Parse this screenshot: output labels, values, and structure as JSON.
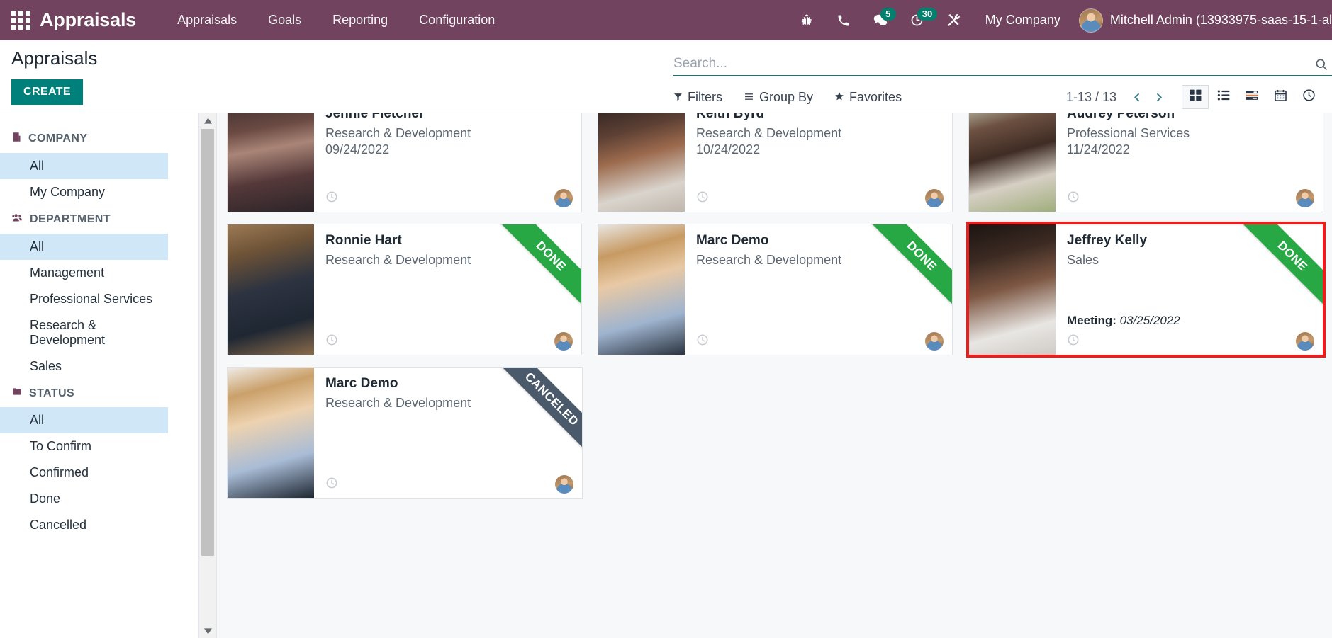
{
  "navbar": {
    "apps_icon": "apps-grid-icon",
    "brand": "Appraisals",
    "menu": [
      {
        "label": "Appraisals"
      },
      {
        "label": "Goals"
      },
      {
        "label": "Reporting"
      },
      {
        "label": "Configuration"
      }
    ],
    "sysicons": [
      {
        "name": "bug-icon",
        "badge": null
      },
      {
        "name": "phone-icon",
        "badge": null
      },
      {
        "name": "messages-icon",
        "badge": "5"
      },
      {
        "name": "activities-clock-icon",
        "badge": "30"
      },
      {
        "name": "tools-icon",
        "badge": null
      }
    ],
    "company": "My Company",
    "user": "Mitchell Admin (13933975-saas-15-1-al",
    "accent": "#71435f",
    "badge_color": "#00806e"
  },
  "control_panel": {
    "title": "Appraisals",
    "create_label": "CREATE",
    "search": {
      "placeholder": "Search...",
      "value": "",
      "icon": "search-icon"
    },
    "filters": [
      {
        "label": "Filters",
        "icon": "filter-funnel-icon"
      },
      {
        "label": "Group By",
        "icon": "group-by-lines-icon"
      },
      {
        "label": "Favorites",
        "icon": "star-icon"
      }
    ],
    "pager": {
      "range": "1-13 / 13",
      "prev_icon": "chevron-left-icon",
      "next_icon": "chevron-right-icon"
    },
    "views": [
      {
        "name": "kanban-view-button",
        "icon": "kanban-grid-icon",
        "active": true
      },
      {
        "name": "list-view-button",
        "icon": "list-icon",
        "active": false
      },
      {
        "name": "activity-view-button",
        "icon": "activity-bars-icon",
        "active": false
      },
      {
        "name": "calendar-view-button",
        "icon": "calendar-icon",
        "active": false
      },
      {
        "name": "timeline-view-button",
        "icon": "clock-icon",
        "active": false
      }
    ]
  },
  "sidebar": {
    "sections": [
      {
        "title": "COMPANY",
        "icon": "building-icon",
        "items": [
          {
            "label": "All",
            "active": true
          },
          {
            "label": "My Company",
            "active": false
          }
        ]
      },
      {
        "title": "DEPARTMENT",
        "icon": "users-icon",
        "items": [
          {
            "label": "All",
            "active": true
          },
          {
            "label": "Management",
            "active": false
          },
          {
            "label": "Professional Services",
            "active": false
          },
          {
            "label": "Research & Development",
            "active": false
          },
          {
            "label": "Sales",
            "active": false
          }
        ]
      },
      {
        "title": "STATUS",
        "icon": "folder-icon",
        "items": [
          {
            "label": "All",
            "active": true
          },
          {
            "label": "To Confirm",
            "active": false
          },
          {
            "label": "Confirmed",
            "active": false
          },
          {
            "label": "Done",
            "active": false
          },
          {
            "label": "Cancelled",
            "active": false
          }
        ]
      }
    ]
  },
  "kanban": {
    "rows": [
      {
        "clipped_top": true,
        "cards": [
          {
            "name": "Jennie Fletcher",
            "department": "Research & Development",
            "date": "09/24/2022",
            "meeting_label": "",
            "meeting_date": "",
            "ribbon": "",
            "highlight": false,
            "photo_class": "ph-jennie"
          },
          {
            "name": "Keith Byrd",
            "department": "Research & Development",
            "date": "10/24/2022",
            "meeting_label": "",
            "meeting_date": "",
            "ribbon": "",
            "highlight": false,
            "photo_class": "ph-keith"
          },
          {
            "name": "Audrey Peterson",
            "department": "Professional Services",
            "date": "11/24/2022",
            "meeting_label": "",
            "meeting_date": "",
            "ribbon": "",
            "highlight": false,
            "photo_class": "ph-audrey"
          }
        ]
      },
      {
        "clipped_top": false,
        "cards": [
          {
            "name": "Ronnie Hart",
            "department": "Research & Development",
            "date": "",
            "meeting_label": "",
            "meeting_date": "",
            "ribbon": "DONE",
            "ribbon_kind": "done",
            "highlight": false,
            "photo_class": "ph-ronnie"
          },
          {
            "name": "Marc Demo",
            "department": "Research & Development",
            "date": "",
            "meeting_label": "",
            "meeting_date": "",
            "ribbon": "DONE",
            "ribbon_kind": "done",
            "highlight": false,
            "photo_class": "ph-marc"
          },
          {
            "name": "Jeffrey Kelly",
            "department": "Sales",
            "date": "",
            "meeting_label": "Meeting:",
            "meeting_date": "03/25/2022",
            "ribbon": "DONE",
            "ribbon_kind": "done",
            "highlight": true,
            "photo_class": "ph-jeffrey"
          }
        ]
      },
      {
        "clipped_top": false,
        "cards": [
          {
            "name": "Marc Demo",
            "department": "Research & Development",
            "date": "",
            "meeting_label": "",
            "meeting_date": "",
            "ribbon": "CANCELED",
            "ribbon_kind": "canceled",
            "highlight": false,
            "photo_class": "ph-marc2"
          }
        ]
      }
    ],
    "highlight_color": "#ef1c1c",
    "done_color": "#28a745",
    "canceled_color": "#4b5a6b"
  }
}
